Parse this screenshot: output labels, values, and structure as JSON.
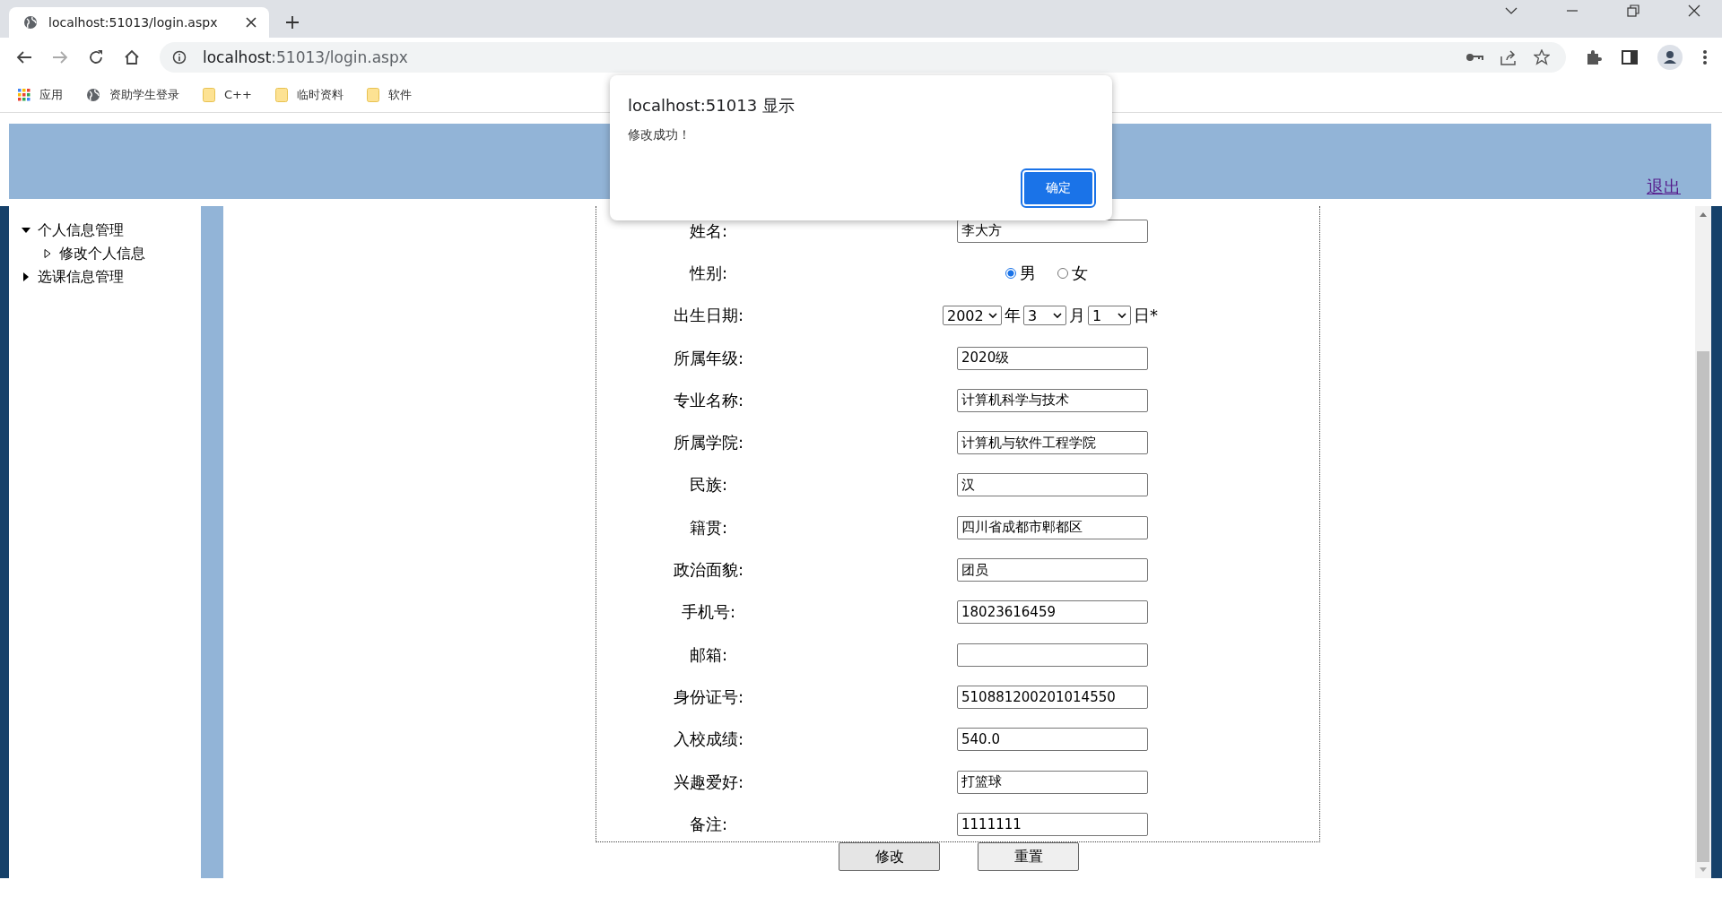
{
  "browser": {
    "tab_title": "localhost:51013/login.aspx",
    "address_host": "localhost",
    "address_rest": ":51013/login.aspx",
    "bookmarks": [
      {
        "kind": "apps",
        "label": "应用"
      },
      {
        "kind": "site",
        "label": "资助学生登录"
      },
      {
        "kind": "folder",
        "label": "C++"
      },
      {
        "kind": "folder",
        "label": "临时资料"
      },
      {
        "kind": "folder",
        "label": "软件"
      }
    ]
  },
  "header": {
    "logout_link": "退出"
  },
  "sidebar": {
    "items": [
      {
        "label": "个人信息管理",
        "expanded": true,
        "children": [
          {
            "label": "修改个人信息",
            "expanded": false
          }
        ]
      },
      {
        "label": "选课信息管理",
        "expanded": false
      }
    ]
  },
  "form": {
    "fields": [
      {
        "kind": "text",
        "label": "姓名:",
        "value": "李大方"
      },
      {
        "kind": "radio",
        "label": "性别:",
        "options": [
          {
            "label": "男",
            "selected": true
          },
          {
            "label": "女",
            "selected": false
          }
        ]
      },
      {
        "kind": "date",
        "label": "出生日期:",
        "year": "2002",
        "year_unit": "年",
        "month": "3",
        "month_unit": "月",
        "day": "1",
        "day_unit": "日*"
      },
      {
        "kind": "text",
        "label": "所属年级:",
        "value": "2020级"
      },
      {
        "kind": "text",
        "label": "专业名称:",
        "value": "计算机科学与技术"
      },
      {
        "kind": "text",
        "label": "所属学院:",
        "value": "计算机与软件工程学院"
      },
      {
        "kind": "text",
        "label": "民族:",
        "value": "汉"
      },
      {
        "kind": "text",
        "label": "籍贯:",
        "value": "四川省成都市郫都区"
      },
      {
        "kind": "text",
        "label": "政治面貌:",
        "value": "团员"
      },
      {
        "kind": "text",
        "label": "手机号:",
        "value": "18023616459"
      },
      {
        "kind": "text",
        "label": "邮箱:"
      },
      {
        "kind": "text",
        "label": "身份证号:",
        "value": "510881200201014550"
      },
      {
        "kind": "text",
        "label": "入校成绩:",
        "value": "540.0"
      },
      {
        "kind": "text",
        "label": "兴趣爱好:",
        "value": "打篮球"
      },
      {
        "kind": "text",
        "label": "备注:",
        "value": "1111111"
      }
    ],
    "buttons": [
      "修改",
      "重置"
    ]
  },
  "dialog": {
    "title": "localhost:51013 显示",
    "message": "修改成功！",
    "button": "确定"
  }
}
